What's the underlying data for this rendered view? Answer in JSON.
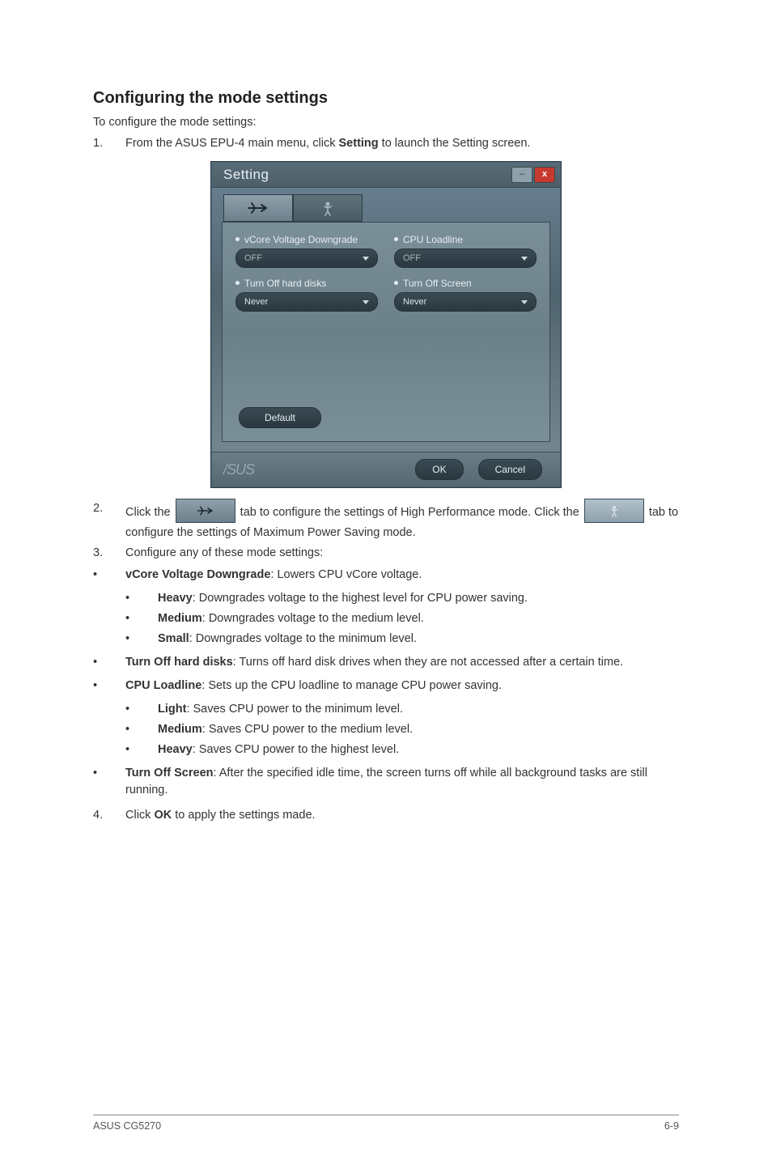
{
  "heading": "Configuring the mode settings",
  "intro": "To configure the mode settings:",
  "step1_num": "1.",
  "step1_a": "From the ASUS EPU-4 main menu, click ",
  "step1_b": "Setting",
  "step1_c": "  to launch the Setting screen.",
  "dialog": {
    "title": "Setting",
    "min_label": "–",
    "close_label": "x",
    "vcore_label": "vCore Voltage Downgrade",
    "vcore_value": "OFF",
    "cpu_label": "CPU Loadline",
    "cpu_value": "OFF",
    "hdd_label": "Turn Off hard disks",
    "hdd_value": "Never",
    "screen_label": "Turn Off Screen",
    "screen_value": "Never",
    "default_btn": "Default",
    "ok_btn": "OK",
    "cancel_btn": "Cancel",
    "logo": "/SUS"
  },
  "step2_num": "2.",
  "step2_a": "Click the ",
  "step2_b": " tab to configure the settings of High Performance mode. Click the ",
  "step2_c": " tab to configure the settings of Maximum Power Saving mode.",
  "step3_num": "3.",
  "step3_text": "Configure any of these mode settings:",
  "b1_dot": "•",
  "b1_a": "vCore Voltage Downgrade",
  "b1_b": ": Lowers CPU vCore voltage.",
  "b1s1_dot": "•",
  "b1s1_a": "Heavy",
  "b1s1_b": ": Downgrades voltage to the highest level for CPU power saving.",
  "b1s2_dot": "•",
  "b1s2_a": "Medium",
  "b1s2_b": ": Downgrades voltage to the medium level.",
  "b1s3_dot": "•",
  "b1s3_a": "Small",
  "b1s3_b": ": Downgrades voltage to the minimum level.",
  "b2_dot": "•",
  "b2_a": "Turn Off hard disks",
  "b2_b": ": Turns off hard disk drives when they are not accessed after a certain time.",
  "b3_dot": "•",
  "b3_a": "CPU Loadline",
  "b3_b": ": Sets up the CPU loadline to manage CPU power saving.",
  "b3s1_dot": "•",
  "b3s1_a": "Light",
  "b3s1_b": ": Saves CPU power to the minimum level.",
  "b3s2_dot": "•",
  "b3s2_a": "Medium",
  "b3s2_b": ": Saves CPU power to the medium level.",
  "b3s3_dot": "•",
  "b3s3_a": "Heavy",
  "b3s3_b": ": Saves CPU power to the highest level.",
  "b4_dot": "•",
  "b4_a": "Turn Off Screen",
  "b4_b": ": After the specified idle time, the screen turns off while all background tasks are still running.",
  "step4_num": "4.",
  "step4_a": "Click ",
  "step4_b": "OK",
  "step4_c": " to apply the settings made.",
  "footer_left": "ASUS CG5270",
  "footer_right": "6-9"
}
